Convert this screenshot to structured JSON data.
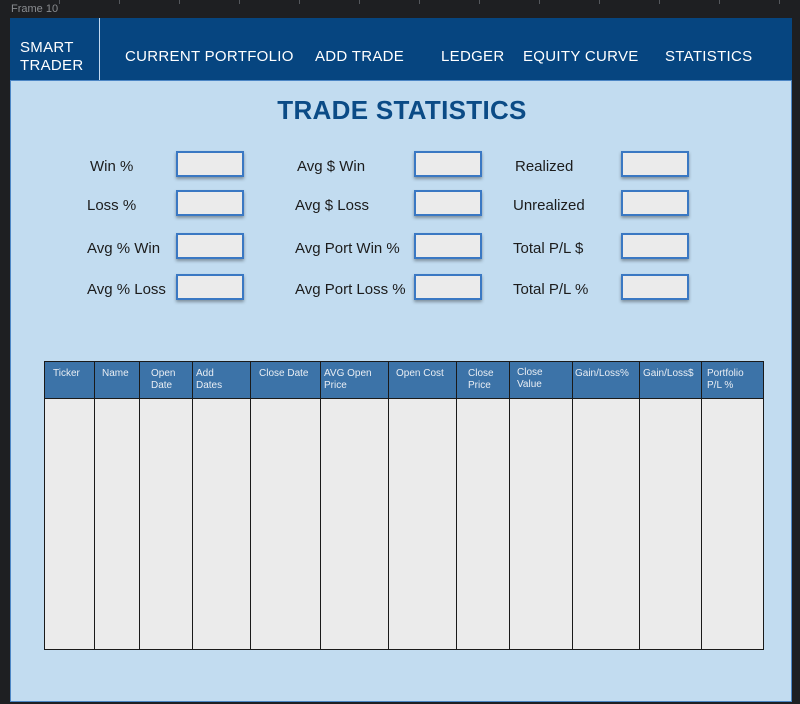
{
  "frame": {
    "label": "Frame 10"
  },
  "brand": {
    "line1": "SMART",
    "line2": "TRADER"
  },
  "nav": {
    "items": [
      {
        "label": "CURRENT PORTFOLIO"
      },
      {
        "label": "ADD TRADE"
      },
      {
        "label": "LEDGER"
      },
      {
        "label": "EQUITY CURVE"
      },
      {
        "label": "STATISTICS"
      }
    ]
  },
  "page": {
    "title": "TRADE STATISTICS"
  },
  "stats": {
    "col1": [
      {
        "label": "Win %",
        "value": ""
      },
      {
        "label": "Loss %",
        "value": ""
      },
      {
        "label": "Avg % Win",
        "value": ""
      },
      {
        "label": "Avg % Loss",
        "value": ""
      }
    ],
    "col2": [
      {
        "label": "Avg $ Win",
        "value": ""
      },
      {
        "label": "Avg $ Loss",
        "value": ""
      },
      {
        "label": "Avg Port Win %",
        "value": ""
      },
      {
        "label": "Avg Port Loss %",
        "value": ""
      }
    ],
    "col3": [
      {
        "label": "Realized",
        "value": ""
      },
      {
        "label": "Unrealized",
        "value": ""
      },
      {
        "label": "Total P/L $",
        "value": ""
      },
      {
        "label": "Total P/L %",
        "value": ""
      }
    ]
  },
  "table": {
    "headers": [
      {
        "line1": "Ticker",
        "line2": ""
      },
      {
        "line1": "Name",
        "line2": ""
      },
      {
        "line1": "Open",
        "line2": "Date"
      },
      {
        "line1": "Add",
        "line2": "Dates"
      },
      {
        "line1": "Close Date",
        "line2": ""
      },
      {
        "line1": "AVG Open",
        "line2": "Price"
      },
      {
        "line1": "Open Cost",
        "line2": ""
      },
      {
        "line1": "Close",
        "line2": "Price"
      },
      {
        "line1": "Close",
        "line2": "Value"
      },
      {
        "line1": "Gain/Loss%",
        "line2": ""
      },
      {
        "line1": "Gain/Loss$",
        "line2": ""
      },
      {
        "line1": "Portfolio",
        "line2": "P/L %"
      }
    ],
    "rows": []
  }
}
